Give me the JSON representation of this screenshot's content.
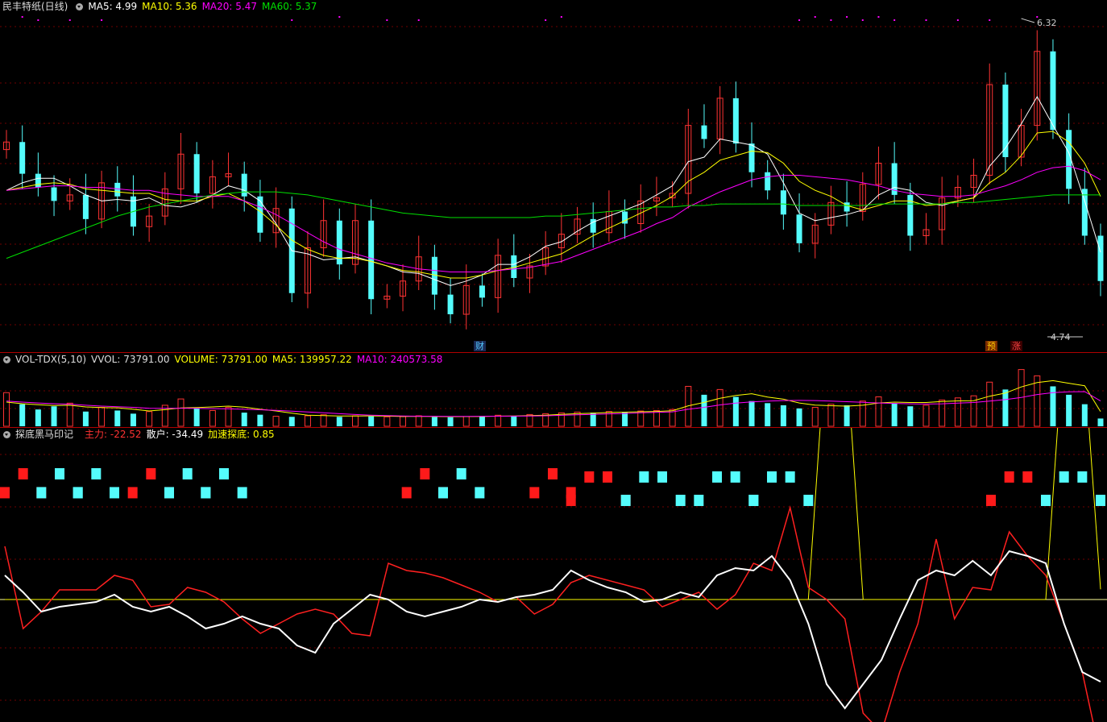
{
  "main_pane": {
    "title": "民丰特纸(日线)",
    "ma5_label": "MA5: 4.99",
    "ma10_label": "MA10: 5.36",
    "ma20_label": "MA20: 5.47",
    "ma60_label": "MA60: 5.37",
    "high_label": "6.32",
    "low_label": "4.74",
    "events": [
      "财",
      "预",
      "涨"
    ]
  },
  "volume_pane": {
    "title": "VOL-TDX(5,10)",
    "vvol_label": "VVOL: 73791.00",
    "volume_label": "VOLUME: 73791.00",
    "ma5_label": "MA5: 139957.22",
    "ma10_label": "MA10: 240573.58"
  },
  "indicator_pane": {
    "title": "探底黑马印记",
    "zhuli_label": "主力: -22.52",
    "sanhu_label": "散户: -34.49",
    "jiasu_label": "加速探底: 0.85"
  },
  "colors": {
    "up": "#ff3333",
    "down": "#54fcfc",
    "ma5": "#ffffff",
    "ma10": "#ffff00",
    "ma20": "#ff00ff",
    "ma60": "#00e000",
    "grid": "#700000",
    "separator": "#b00000"
  },
  "chart_data": [
    {
      "type": "candlestick",
      "series": [
        {
          "name": "K",
          "values": [
            5.72,
            5.51,
            5.42,
            5.33,
            5.37,
            5.21,
            5.45,
            5.36,
            5.16,
            5.23,
            5.41,
            5.64,
            5.38,
            5.49,
            5.51,
            5.36,
            5.12,
            5.28,
            4.72,
            5.02,
            5.2,
            4.91,
            5.2,
            4.68,
            4.7,
            4.8,
            4.96,
            4.71,
            4.58,
            4.77,
            4.69,
            4.97,
            4.82,
            4.9,
            5.02,
            5.11,
            5.21,
            5.12,
            5.26,
            5.18,
            5.33,
            5.35,
            5.38,
            5.83,
            5.74,
            6.01,
            5.71,
            5.52,
            5.4,
            5.24,
            5.05,
            5.17,
            5.32,
            5.26,
            5.44,
            5.58,
            5.37,
            5.1,
            5.14,
            5.35,
            5.42,
            5.5,
            6.1,
            5.62,
            5.83,
            6.32,
            5.8,
            5.41,
            5.1,
            4.8
          ]
        },
        {
          "name": "MA5",
          "values": [
            5.4,
            5.45,
            5.48,
            5.48,
            5.43,
            5.37,
            5.33,
            5.34,
            5.33,
            5.35,
            5.3,
            5.29,
            5.32,
            5.37,
            5.43,
            5.4,
            5.33,
            5.18,
            5.0,
            4.98,
            4.94,
            4.95,
            4.96,
            4.93,
            4.9,
            4.86,
            4.85,
            4.81,
            4.77,
            4.8,
            4.84,
            4.91,
            4.91,
            4.96,
            5.03,
            5.06,
            5.13,
            5.19,
            5.23,
            5.27,
            5.31,
            5.37,
            5.43,
            5.59,
            5.62,
            5.74,
            5.72,
            5.7,
            5.64,
            5.45,
            5.25,
            5.2,
            5.22,
            5.24,
            5.27,
            5.37,
            5.42,
            5.4,
            5.32,
            5.3,
            5.33,
            5.35,
            5.56,
            5.68,
            5.84,
            6.02,
            5.83,
            5.65,
            5.33,
            4.99
          ]
        },
        {
          "name": "MA10",
          "values": [
            5.4,
            5.42,
            5.44,
            5.45,
            5.44,
            5.41,
            5.4,
            5.39,
            5.38,
            5.38,
            5.34,
            5.33,
            5.33,
            5.36,
            5.38,
            5.33,
            5.26,
            5.17,
            5.07,
            5.01,
            4.97,
            4.95,
            4.95,
            4.93,
            4.9,
            4.87,
            4.86,
            4.84,
            4.82,
            4.82,
            4.84,
            4.87,
            4.89,
            4.92,
            4.95,
            4.98,
            5.04,
            5.1,
            5.15,
            5.2,
            5.25,
            5.3,
            5.36,
            5.46,
            5.52,
            5.6,
            5.63,
            5.66,
            5.65,
            5.58,
            5.46,
            5.4,
            5.36,
            5.3,
            5.27,
            5.3,
            5.33,
            5.33,
            5.3,
            5.31,
            5.33,
            5.35,
            5.45,
            5.52,
            5.63,
            5.78,
            5.79,
            5.72,
            5.58,
            5.36
          ]
        },
        {
          "name": "MA20",
          "values": [
            5.4,
            5.41,
            5.42,
            5.43,
            5.43,
            5.42,
            5.42,
            5.41,
            5.4,
            5.4,
            5.38,
            5.37,
            5.36,
            5.36,
            5.36,
            5.33,
            5.29,
            5.24,
            5.18,
            5.12,
            5.06,
            5.01,
            4.98,
            4.95,
            4.92,
            4.9,
            4.88,
            4.87,
            4.86,
            4.86,
            4.86,
            4.87,
            4.88,
            4.89,
            4.91,
            4.93,
            4.97,
            5.01,
            5.05,
            5.09,
            5.13,
            5.18,
            5.22,
            5.29,
            5.34,
            5.39,
            5.43,
            5.47,
            5.49,
            5.5,
            5.5,
            5.49,
            5.48,
            5.47,
            5.45,
            5.43,
            5.4,
            5.38,
            5.37,
            5.36,
            5.36,
            5.37,
            5.4,
            5.43,
            5.47,
            5.52,
            5.55,
            5.56,
            5.53,
            5.47
          ]
        },
        {
          "name": "MA60",
          "values": [
            4.95,
            4.99,
            5.03,
            5.07,
            5.11,
            5.15,
            5.19,
            5.23,
            5.26,
            5.29,
            5.31,
            5.33,
            5.35,
            5.37,
            5.38,
            5.39,
            5.39,
            5.39,
            5.38,
            5.37,
            5.35,
            5.33,
            5.31,
            5.29,
            5.27,
            5.25,
            5.24,
            5.23,
            5.22,
            5.22,
            5.22,
            5.22,
            5.22,
            5.22,
            5.23,
            5.23,
            5.24,
            5.25,
            5.26,
            5.27,
            5.28,
            5.29,
            5.29,
            5.3,
            5.3,
            5.31,
            5.31,
            5.31,
            5.31,
            5.31,
            5.3,
            5.3,
            5.3,
            5.3,
            5.3,
            5.31,
            5.31,
            5.31,
            5.31,
            5.31,
            5.32,
            5.32,
            5.33,
            5.34,
            5.35,
            5.36,
            5.37,
            5.37,
            5.37,
            5.37
          ]
        }
      ],
      "annotations": [
        "6.32",
        "4.74"
      ]
    },
    {
      "type": "bar",
      "series": [
        {
          "name": "VOLUME",
          "values": [
            320000,
            210000,
            160000,
            190000,
            220000,
            140000,
            180000,
            150000,
            120000,
            140000,
            200000,
            260000,
            170000,
            150000,
            180000,
            130000,
            110000,
            95000,
            90000,
            100000,
            110000,
            90000,
            100000,
            95000,
            90000,
            92000,
            100000,
            88000,
            86000,
            92000,
            95000,
            105000,
            100000,
            112000,
            120000,
            128000,
            135000,
            130000,
            140000,
            138000,
            145000,
            150000,
            160000,
            380000,
            300000,
            350000,
            280000,
            240000,
            220000,
            200000,
            170000,
            180000,
            210000,
            200000,
            240000,
            280000,
            220000,
            190000,
            200000,
            250000,
            270000,
            290000,
            420000,
            350000,
            540000,
            480000,
            380000,
            300000,
            210000,
            73791
          ]
        },
        {
          "name": "MA5",
          "values": [
            230000,
            215000,
            205000,
            198000,
            200000,
            184000,
            178000,
            176000,
            162000,
            146000,
            158000,
            174000,
            178000,
            184000,
            192000,
            182000,
            162000,
            146000,
            125000,
            105000,
            101000,
            98000,
            98000,
            99000,
            97000,
            93000,
            95000,
            93000,
            91000,
            92000,
            93000,
            97000,
            98000,
            101000,
            106000,
            113000,
            120000,
            125000,
            131000,
            134000,
            138000,
            141000,
            147000,
            195000,
            227000,
            267000,
            294000,
            310000,
            278000,
            258000,
            222000,
            202000,
            196000,
            192000,
            200000,
            222000,
            230000,
            226000,
            226000,
            236000,
            242000,
            244000,
            286000,
            316000,
            374000,
            416000,
            434000,
            410000,
            386000,
            139957
          ]
        },
        {
          "name": "MA10",
          "values": [
            240000,
            230000,
            222000,
            215000,
            210000,
            200000,
            192000,
            186000,
            180000,
            172000,
            170000,
            172000,
            170000,
            168000,
            166000,
            162000,
            157000,
            152000,
            144000,
            136000,
            128000,
            120000,
            112000,
            106000,
            101000,
            98000,
            96000,
            95000,
            94000,
            94000,
            95000,
            96000,
            97000,
            98000,
            100000,
            104000,
            109000,
            113000,
            118000,
            122000,
            128000,
            132000,
            137000,
            162000,
            180000,
            203000,
            220000,
            232000,
            240000,
            245000,
            246000,
            245000,
            240000,
            234000,
            228000,
            222000,
            218000,
            214000,
            212000,
            214000,
            220000,
            226000,
            240000,
            254000,
            275000,
            302000,
            320000,
            328000,
            330000,
            240574
          ]
        }
      ]
    },
    {
      "type": "line",
      "series": [
        {
          "name": "主力",
          "values": [
            22,
            -12,
            -5,
            4,
            4,
            4,
            10,
            8,
            -3,
            -2,
            5,
            3,
            -1,
            -8,
            -14,
            -10,
            -6,
            -4,
            -6,
            -14,
            -15,
            15,
            12,
            11,
            9,
            6,
            3,
            -1,
            1,
            -6,
            -2,
            7,
            10,
            8,
            6,
            4,
            -3,
            0,
            3,
            -4,
            2,
            15,
            12,
            38,
            5,
            0,
            -8,
            -47,
            -55,
            -30,
            -10,
            25,
            -8,
            5,
            4,
            28,
            18,
            10,
            -10,
            -30,
            -65
          ]
        },
        {
          "name": "散户",
          "values": [
            10,
            3,
            -5,
            -3,
            -2,
            -1,
            2,
            -3,
            -5,
            -3,
            -7,
            -12,
            -10,
            -7,
            -10,
            -12,
            -19,
            -22,
            -10,
            -4,
            2,
            0,
            -5,
            -7,
            -5,
            -3,
            0,
            -1,
            1,
            2,
            4,
            12,
            8,
            5,
            3,
            -1,
            0,
            3,
            1,
            10,
            13,
            12,
            18,
            8,
            -10,
            -35,
            -45,
            -35,
            -25,
            -8,
            8,
            12,
            10,
            16,
            10,
            20,
            18,
            15,
            -10,
            -30,
            -34
          ]
        },
        {
          "name": "加速探底",
          "values": [
            0,
            0,
            0,
            0,
            0,
            0,
            0,
            0,
            0,
            0,
            0,
            0,
            0,
            0,
            0,
            0,
            0,
            0,
            0,
            0,
            0,
            0,
            0,
            0,
            0,
            0,
            0,
            0,
            0,
            0,
            0,
            0,
            0,
            0,
            0,
            0,
            0,
            0,
            0,
            0,
            0,
            0,
            0,
            0,
            0,
            22,
            22,
            0,
            0,
            0,
            0,
            0,
            0,
            0,
            0,
            0,
            0,
            0,
            22,
            22,
            0.85
          ]
        }
      ]
    }
  ]
}
